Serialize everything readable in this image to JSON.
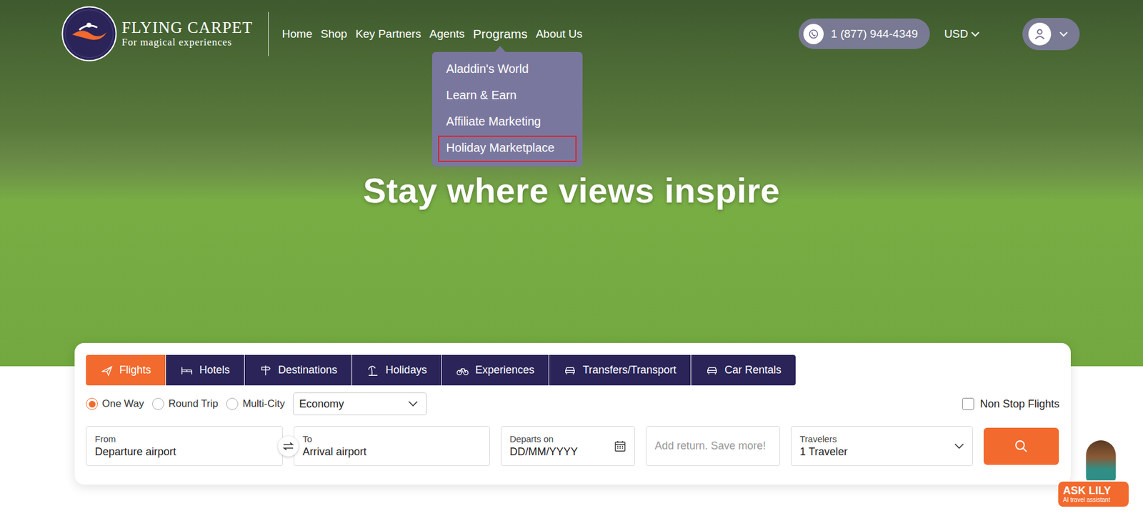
{
  "brand": {
    "name": "FLYING CARPET",
    "tagline": "For magical experiences"
  },
  "nav": [
    {
      "label": "Home",
      "expanded": false
    },
    {
      "label": "Shop",
      "expanded": false
    },
    {
      "label": "Key Partners",
      "expanded": false
    },
    {
      "label": "Agents",
      "expanded": false
    },
    {
      "label": "Programs",
      "expanded": true
    },
    {
      "label": "About Us",
      "expanded": false
    }
  ],
  "dropdown": [
    {
      "label": "Aladdin's World",
      "selected": false
    },
    {
      "label": "Learn & Earn",
      "selected": false
    },
    {
      "label": "Affiliate Marketing",
      "selected": false
    },
    {
      "label": "Holiday Marketplace",
      "selected": true
    }
  ],
  "phone": "1 (877) 944-4349",
  "currency": "USD",
  "hero": {
    "headline": "Stay where views inspire"
  },
  "search": {
    "tabs": [
      {
        "label": "Flights",
        "selected": true
      },
      {
        "label": "Hotels",
        "selected": false
      },
      {
        "label": "Destinations",
        "selected": false
      },
      {
        "label": "Holidays",
        "selected": false
      },
      {
        "label": "Experiences",
        "selected": false
      },
      {
        "label": "Transfers/Transport",
        "selected": false
      },
      {
        "label": "Car Rentals",
        "selected": false
      }
    ],
    "trip_types": [
      {
        "label": "One Way",
        "selected": true
      },
      {
        "label": "Round Trip",
        "selected": false
      },
      {
        "label": "Multi-City",
        "selected": false
      }
    ],
    "cabin": "Economy",
    "non_stop": {
      "label": "Non Stop Flights",
      "checked": false
    },
    "from": {
      "label": "From",
      "value": "Departure airport"
    },
    "to": {
      "label": "To",
      "value": "Arrival airport"
    },
    "departs": {
      "label": "Departs on",
      "value": "DD/MM/YYYY"
    },
    "return_placeholder": "Add return. Save more!",
    "travelers": {
      "label": "Travelers",
      "value": "1 Traveler"
    }
  },
  "assistant": {
    "title": "ASK LILY",
    "subtitle": "AI travel assistant"
  }
}
